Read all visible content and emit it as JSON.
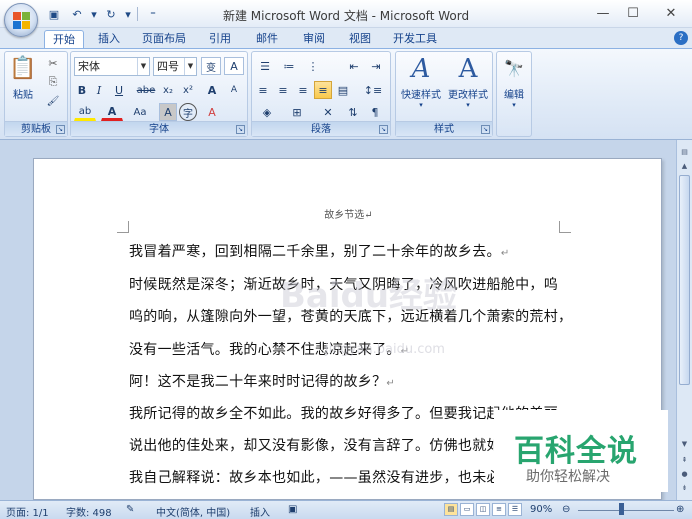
{
  "window": {
    "title": "新建 Microsoft Word 文档 - Microsoft Word",
    "minimize_icon": "—",
    "maximize_icon": "☐",
    "close_icon": "✕"
  },
  "qat": {
    "save_icon": "▣",
    "undo_icon": "↶",
    "undo_dd": "▾",
    "redo_icon": "↻",
    "redo_dd": "▾",
    "customize_icon": "⁼"
  },
  "tabs": [
    "开始",
    "插入",
    "页面布局",
    "引用",
    "邮件",
    "审阅",
    "视图",
    "开发工具"
  ],
  "ribbon": {
    "clipboard": {
      "label": "剪贴板",
      "paste": "粘贴",
      "cut_icon": "✂",
      "copy_icon": "⎘",
      "format_painter_icon": "🖌"
    },
    "font": {
      "label": "字体",
      "name": "宋体",
      "size": "四号",
      "pinyin_icon": "变",
      "charborder_icon": "A",
      "bold": "B",
      "italic": "I",
      "underline": "U",
      "strike": "abe",
      "subscript": "x₂",
      "superscript": "x²",
      "case_icon": "Aa",
      "clear_icon": "A",
      "highlight_icon": "ab",
      "fontcolor_icon": "A",
      "shading_icon": "A",
      "enclose_icon": "字",
      "grow_icon": "A",
      "shrink_icon": "A"
    },
    "paragraph": {
      "label": "段落"
    },
    "styles": {
      "label": "样式",
      "quick": "快速样式",
      "change": "更改样式"
    },
    "editing": {
      "label": "编辑",
      "icon": "🔭"
    }
  },
  "document": {
    "header": "故乡节选↵",
    "paragraphs": [
      "我冒着严寒，回到相隔二千余里，别了二十余年的故乡去。",
      "时候既然是深冬；渐近故乡时，天气又阴晦了，冷风吹进船舱中，呜",
      "呜的响，从篷隙向外一望，苍黄的天底下，远近横着几个萧索的荒村，",
      "没有一些活气。我的心禁不住悲凉起来了。",
      "阿！这不是我二十年来时时记得的故乡？",
      "我所记得的故乡全不如此。我的故乡好得多了。但要我记起他的美丽，",
      "说出他的佳处来，却又没有影像，没有言辞了。仿佛也就如此。于是",
      "我自己解释说：故乡本也如此，——虽然没有进步，也未必"
    ],
    "paragraph_mark": "↵"
  },
  "watermark": {
    "brand": "Baidu经验",
    "url": "jingyan.baidu.com"
  },
  "overlay": {
    "title": "百科全说",
    "subtitle": "助你轻松解决"
  },
  "status": {
    "page": "页面: 1/1",
    "words": "字数: 498",
    "language": "中文(简体, 中国)",
    "mode": "插入",
    "zoom": "90%",
    "zoom_value": 90
  },
  "colors": {
    "accent": "#15428b",
    "ribbon_bg": "#dfe9f5",
    "overlay_green": "#28a56f"
  }
}
